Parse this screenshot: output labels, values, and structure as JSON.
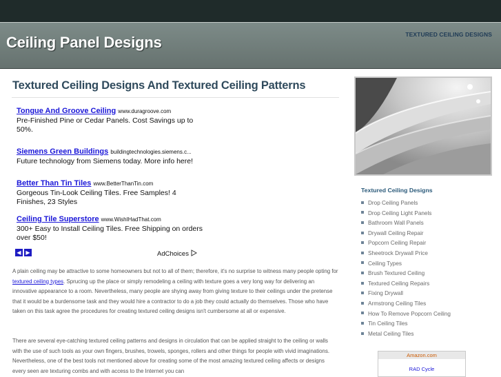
{
  "header": {
    "site_title": "Ceiling Panel Designs",
    "top_link": "TEXTURED CEILING DESIGNS"
  },
  "main": {
    "title": "Textured Ceiling Designs And Textured Ceiling Patterns",
    "ads": [
      {
        "title": "Tongue And Groove Ceiling",
        "url": "www.duragroove.com",
        "text": "Pre-Finished Pine or Cedar Panels. Cost Savings up to 50%."
      },
      {
        "title": "Siemens Green Buildings",
        "url": "buildingtechnologies.siemens.c...",
        "text": "Future technology from Siemens today. More info here!"
      },
      {
        "title": "Better Than Tin Tiles",
        "url": "www.BetterThanTin.com",
        "text": "Gorgeous Tin-Look Ceiling Tiles. Free Samples! 4 Finishes, 23 Styles"
      },
      {
        "title": "Ceiling Tile Superstore",
        "url": "www.WishIHadThat.com",
        "text": "300+ Easy to Install Ceiling Tiles. Free Shipping on orders over $50!"
      }
    ],
    "ad_prev": "◀",
    "ad_next": "▶",
    "adchoices": "AdChoices",
    "para1_start": "A plain ceiling may be attractive to some homeowners but not to all of them; therefore, it's no surprise to witness many people opting for ",
    "para1_link": "textured ceiling types",
    "para1_end": ". Sprucing up the place or simply remodeling a ceiling with texture goes a very long way for delivering an innovative appearance to a room. Nevertheless, many people are shying away from giving texture to their ceilings under the pretense that it would be a burdensome task and they would hire a contractor to do a job they could actually do themselves. Those who have taken on this task agree the procedures for creating textured ceiling designs isn't cumbersome at all or expensive.",
    "para2": "There are several eye-catching textured ceiling patterns and designs in circulation that can be applied straight to the ceiling or walls with the use of such tools as your own fingers, brushes, trowels, sponges, rollers and other things for people with vivid imaginations. Nevertheless, one of the best tools not mentioned above for creating some of the most amazing textured ceiling affects or designs every seen are texturing combs and with access to the Internet you can"
  },
  "sidebar": {
    "heading": "Textured Ceiling Designs",
    "items": [
      "Drop Ceiling Panels",
      "Drop Ceiling Light Panels",
      "Bathroom Wall Panels",
      "Drywall Ceiling Repair",
      "Popcorn Ceiling Repair",
      "Sheetrock Drywall Price",
      "Ceiling Types",
      "Brush Textured Ceiling",
      "Textured Ceiling Repairs",
      "Fixing Drywall",
      "Armstrong Ceiling Tiles",
      "How To Remove Popcorn Ceiling",
      "Tin Ceiling Tiles",
      "Metal Ceiling Tiles"
    ],
    "amazon_header": "Amazon.com",
    "amazon_item": "RAD Cycle"
  }
}
